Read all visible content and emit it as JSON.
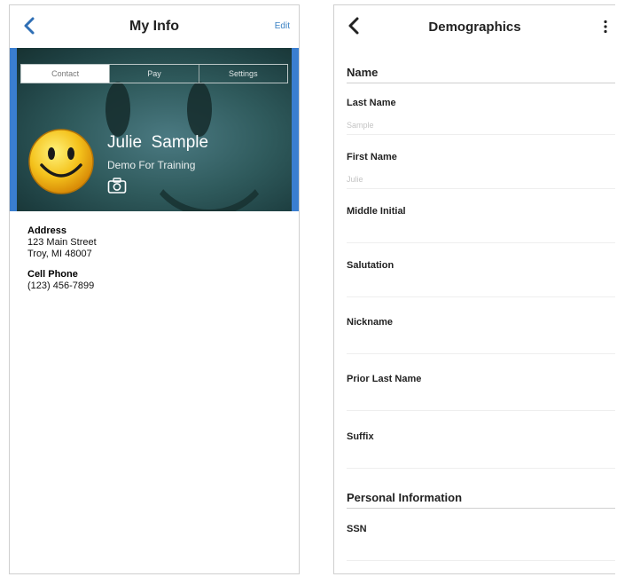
{
  "my_info": {
    "title": "My Info",
    "edit_label": "Edit",
    "tabs": [
      {
        "label": "Contact",
        "active": true
      },
      {
        "label": "Pay",
        "active": false
      },
      {
        "label": "Settings",
        "active": false
      }
    ],
    "profile": {
      "name": "Julie  Sample",
      "subtitle": "Demo For Training"
    },
    "address": {
      "label": "Address",
      "line1": "123 Main Street",
      "line2": "Troy, MI 48007"
    },
    "cell_phone": {
      "label": "Cell Phone",
      "value": "(123) 456-7899"
    },
    "accent_color": "#3b82c4"
  },
  "demographics": {
    "title": "Demographics",
    "name_section": "Name",
    "fields": [
      {
        "label": "Last Name",
        "value": "Sample"
      },
      {
        "label": "First Name",
        "value": "Julie"
      },
      {
        "label": "Middle Initial",
        "value": ""
      },
      {
        "label": "Salutation",
        "value": ""
      },
      {
        "label": "Nickname",
        "value": ""
      },
      {
        "label": "Prior Last Name",
        "value": ""
      },
      {
        "label": "Suffix",
        "value": ""
      }
    ],
    "personal_section": "Personal Information",
    "ssn": {
      "label": "SSN",
      "value": ""
    }
  },
  "icons": [
    "back-chevron-icon",
    "camera-icon",
    "smiley-avatar-icon",
    "more-vertical-icon"
  ]
}
